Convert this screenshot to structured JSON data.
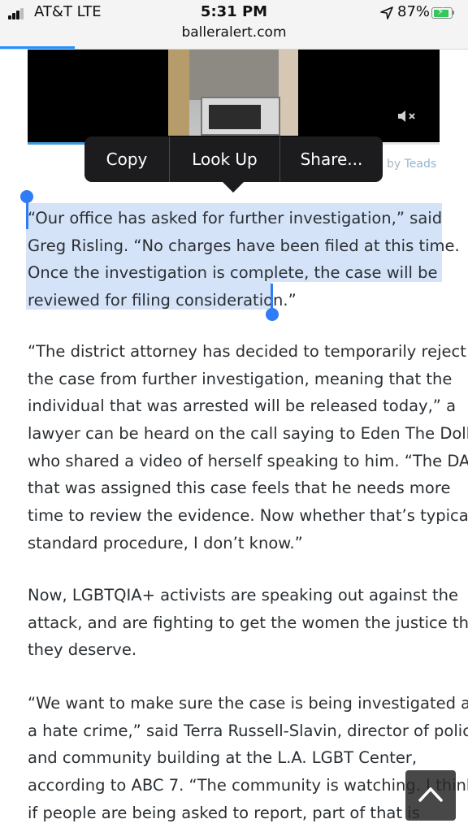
{
  "status_bar": {
    "carrier": "AT&T  LTE",
    "time": "5:31 PM",
    "battery_percent": "87%",
    "battery_level": 0.87,
    "url": "balleralert.com",
    "page_load_progress": 0.16
  },
  "video_ad": {
    "progress": 0.14,
    "sponsor_prefix": "by",
    "sponsor_name": "Teads",
    "mute_icon": "speaker-muted-icon"
  },
  "context_menu": {
    "copy": "Copy",
    "look_up": "Look Up",
    "share": "Share..."
  },
  "article": {
    "paragraph_1": [
      "“Our office has asked for further investigation,” said",
      "Greg Risling. “No charges have been filed at this time.",
      "Once the investigation is complete, the case will be",
      "reviewed for filing consideration.”"
    ],
    "paragraph_2": [
      "“The district attorney has decided to temporarily reject",
      "the case from further investigation, meaning that the",
      "individual that was arrested will be released today,” a",
      "lawyer can be heard on the call saying to Eden The Doll,",
      "who shared a video of herself speaking to him. “The DA",
      "that was assigned this case feels that he needs more",
      "time to review the evidence. Now whether that’s typical",
      "standard procedure, I don’t know.”"
    ],
    "paragraph_3": [
      "Now, LGBTQIA+ activists are speaking out against the",
      "attack, and are fighting to get the women the justice that",
      "they deserve."
    ],
    "paragraph_4": [
      "“We want to make sure the case is being investigated as",
      "a hate crime,” said Terra Russell-Slavin, director of policy",
      "and community building at the L.A. LGBT Center,",
      "according to ABC 7. “The community is watching. I think",
      "if people are being asked to report, part of that is"
    ]
  },
  "colors": {
    "selection": "#d5e3f8",
    "selection_handle": "#2f7cf6",
    "menu_bg": "#1c1c1e",
    "text": "#2a2f33",
    "battery": "#34c759"
  },
  "scroll_top_icon": "chevron-up-icon"
}
